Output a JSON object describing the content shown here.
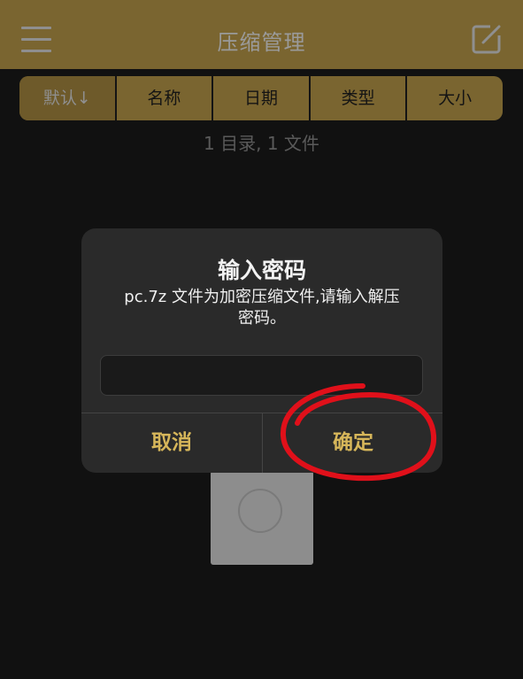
{
  "header": {
    "title": "压缩管理",
    "menu_icon": "hamburger-menu-icon",
    "edit_icon": "edit-icon"
  },
  "sort": {
    "options": [
      {
        "label": "默认↓",
        "active": true
      },
      {
        "label": "名称",
        "active": false
      },
      {
        "label": "日期",
        "active": false
      },
      {
        "label": "类型",
        "active": false
      },
      {
        "label": "大小",
        "active": false
      }
    ]
  },
  "summary": "1 目录, 1 文件",
  "dialog": {
    "title": "输入密码",
    "message": "pc.7z 文件为加密压缩文件,请输入解压密码。",
    "password_value": "",
    "cancel_label": "取消",
    "confirm_label": "确定"
  },
  "colors": {
    "accent": "#7a6530",
    "button_text": "#d6b65a",
    "annotation": "#e0101a"
  }
}
